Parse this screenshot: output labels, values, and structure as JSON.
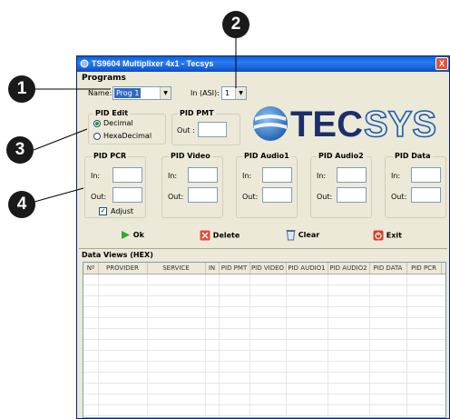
{
  "window": {
    "title": "TS9604 Multiplixer 4x1 - Tecsys",
    "close_label": "X"
  },
  "programs": {
    "heading": "Programs",
    "name_label": "Name:",
    "name_value": "Prog 1",
    "in_label": "In (ASI):",
    "in_value": "1"
  },
  "pid_edit": {
    "legend": "PID Edit",
    "decimal_label": "Decimal",
    "hex_label": "HexaDecimal",
    "selected": "Decimal"
  },
  "pid_pmt": {
    "legend": "PID PMT",
    "out_label": "Out :"
  },
  "logo": {
    "text_solid": "TEC",
    "text_outline": "SYS"
  },
  "pid_pcr": {
    "legend": "PID PCR",
    "in_label": "In:",
    "out_label": "Out:",
    "adjust_label": "Adjust",
    "adjust_checked": true
  },
  "pid_video": {
    "legend": "PID Video",
    "in_label": "In:",
    "out_label": "Out:"
  },
  "pid_audio1": {
    "legend": "PID Audio1",
    "in_label": "In:",
    "out_label": "Out:"
  },
  "pid_audio2": {
    "legend": "PID Audio2",
    "in_label": "In:",
    "out_label": "Out:"
  },
  "pid_data": {
    "legend": "PID Data",
    "in_label": "In:",
    "out_label": "Out:"
  },
  "actions": {
    "ok": "Ok",
    "delete": "Delete",
    "clear": "Clear",
    "exit": "Exit"
  },
  "data_views": {
    "heading": "Data Views (HEX)",
    "columns": [
      "Nº",
      "PROVIDER",
      "SERVICE",
      "IN",
      "PID PMT",
      "PID VIDEO",
      "PID AUDIO1",
      "PID AUDIO2",
      "PID DATA",
      "PID PCR"
    ]
  },
  "callouts": [
    "1",
    "2",
    "3",
    "4"
  ],
  "colors": {
    "titlebar": "#0a5fd8",
    "logo_blue": "#1d5fae",
    "logo_dark": "#1b2f6b"
  }
}
